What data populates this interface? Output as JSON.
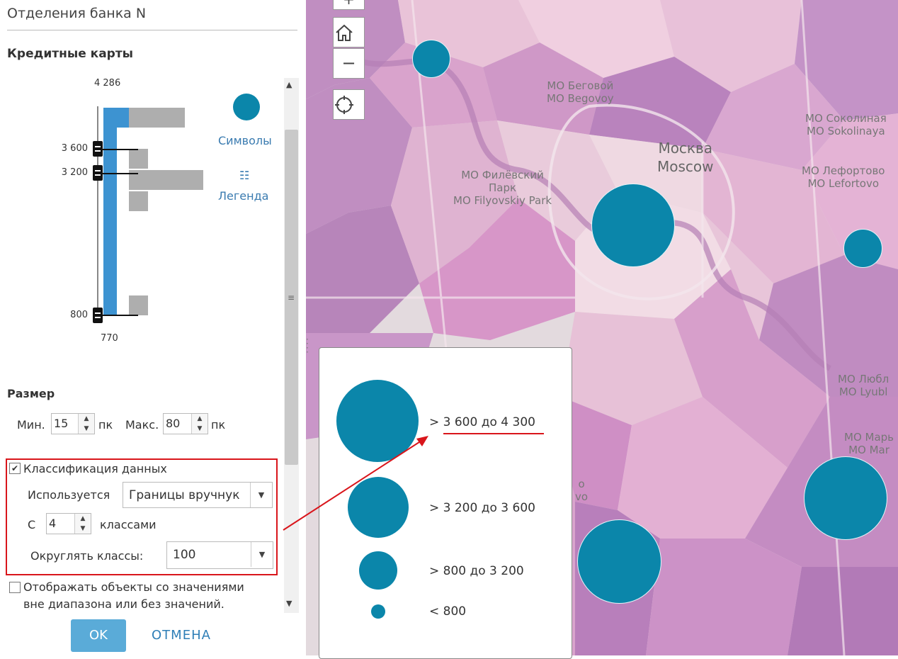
{
  "panel": {
    "title": "Отделения банка N",
    "section_title": "Кредитные карты",
    "histogram": {
      "max_label": "4 286",
      "min_label": "770",
      "breaks": [
        "3 600",
        "3 200",
        "800"
      ]
    },
    "symbols_label": "Символы",
    "legend_label": "Легенда",
    "size": {
      "title": "Размер",
      "min_label": "Мин.",
      "min_value": "15",
      "max_label": "Макс.",
      "max_value": "80",
      "unit": "пк"
    },
    "classification": {
      "checkbox_label": "Классификация данных",
      "checked": true,
      "method_label": "Используется",
      "method_value": "Границы вручнук",
      "classes_prefix": "С",
      "classes_value": "4",
      "classes_suffix": "классами",
      "round_label": "Округлять классы:",
      "round_value": "100"
    },
    "out_of_range": {
      "label_line1": "Отображать объекты со значениями",
      "label_line2": "вне диапазона или без значений.",
      "checked": false
    },
    "ok_label": "OK",
    "cancel_label": "ОТМЕНА"
  },
  "map": {
    "city_ru": "Москва",
    "city_en": "Moscow",
    "districts": [
      {
        "ru": "МО Беговой",
        "en": "MO Begovoy"
      },
      {
        "ru": "МО Соколиная",
        "en": "MO Sokolinaya"
      },
      {
        "ru": "МО Филёвский",
        "ru2": "Парк",
        "en": "MO Filyovskiy Park"
      },
      {
        "ru": "МО Лефортово",
        "en": "MO Lefortovo"
      },
      {
        "ru": "МО Любл",
        "en": "MO Lyubl"
      },
      {
        "ru": "МО Марь",
        "en": "MO Mar"
      },
      {
        "ru": "о",
        "en": "vo"
      }
    ],
    "controls": {
      "zoom_in": "+",
      "home": "home-icon",
      "zoom_out": "−",
      "locate": "locate-icon"
    }
  },
  "legend": {
    "items": [
      {
        "label": "> 3 600 до 4 300"
      },
      {
        "label": "> 3 200 до 3 600"
      },
      {
        "label": "> 800 до 3 200"
      },
      {
        "label": "< 800"
      }
    ]
  },
  "colors": {
    "accent": "#0b86aa",
    "highlight": "#d9151b",
    "button": "#5aabd8"
  }
}
